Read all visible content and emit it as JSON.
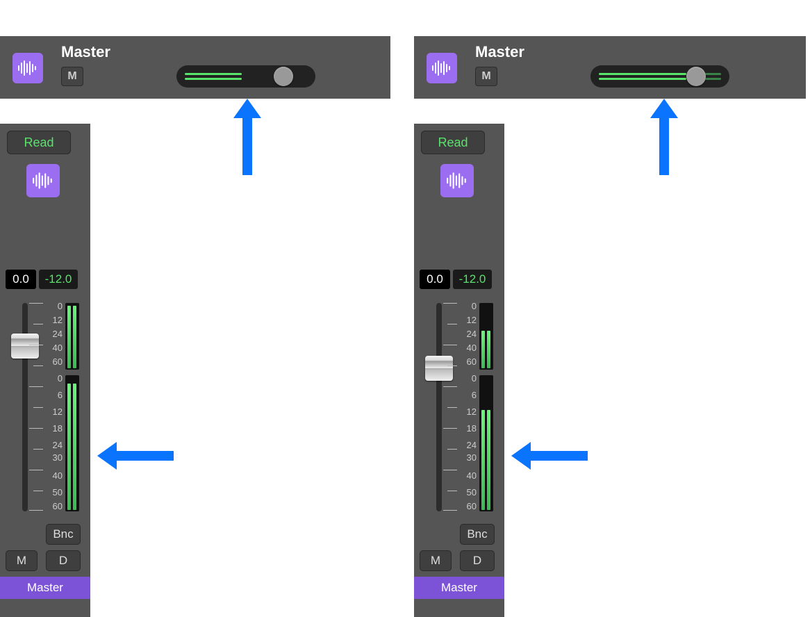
{
  "left": {
    "header": {
      "title": "Master",
      "mute": "M",
      "vol_fill_frac": 0.48,
      "thumb_frac": 0.7
    },
    "strip": {
      "automation": "Read",
      "gain": "0.0",
      "peak": "-12.0",
      "small_meter_labels": [
        "0",
        "12",
        "24",
        "40",
        "60"
      ],
      "big_meter_labels": [
        "0",
        "6",
        "12",
        "18",
        "24",
        "30",
        "40",
        "50",
        "60"
      ],
      "small_meter_fill_frac": 0.95,
      "big_meter_fill_frac": 0.92,
      "bnc": "Bnc",
      "mute": "M",
      "dim": "D",
      "name": "Master"
    }
  },
  "right": {
    "header": {
      "title": "Master",
      "mute": "M",
      "vol_fill_frac": 0.85,
      "thumb_frac": 0.74
    },
    "strip": {
      "automation": "Read",
      "gain": "0.0",
      "peak": "-12.0",
      "small_meter_labels": [
        "0",
        "12",
        "24",
        "40",
        "60"
      ],
      "big_meter_labels": [
        "0",
        "6",
        "12",
        "18",
        "24",
        "30",
        "40",
        "50",
        "60"
      ],
      "small_meter_fill_frac": 0.55,
      "big_meter_fill_frac": 0.72,
      "bnc": "Bnc",
      "mute": "M",
      "dim": "D",
      "name": "Master"
    }
  },
  "icons": {
    "waveform": "waveform-icon"
  }
}
